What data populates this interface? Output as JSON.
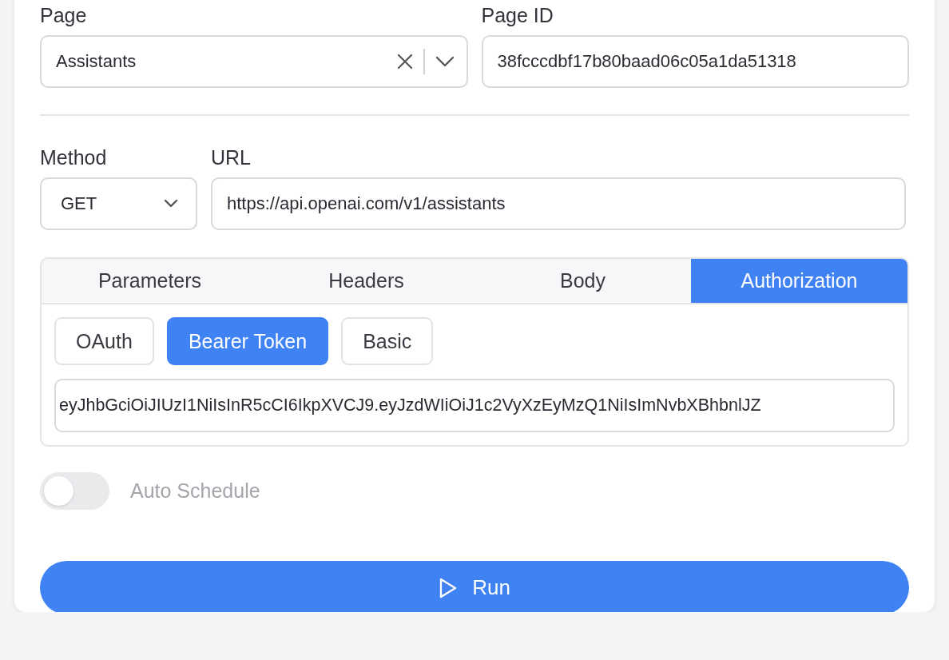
{
  "page_field": {
    "label": "Page",
    "value": "Assistants"
  },
  "page_id_field": {
    "label": "Page ID",
    "value": "38fcccdbf17b80baad06c05a1da51318"
  },
  "method_field": {
    "label": "Method",
    "value": "GET"
  },
  "url_field": {
    "label": "URL",
    "value": "https://api.openai.com/v1/assistants"
  },
  "tabs": [
    {
      "label": "Parameters",
      "selected": false
    },
    {
      "label": "Headers",
      "selected": false
    },
    {
      "label": "Body",
      "selected": false
    },
    {
      "label": "Authorization",
      "selected": true
    }
  ],
  "auth_types": [
    {
      "label": "OAuth",
      "selected": false
    },
    {
      "label": "Bearer Token",
      "selected": true
    },
    {
      "label": "Basic",
      "selected": false
    }
  ],
  "token_field": {
    "value": "eyJhbGciOiJIUzI1NiIsInR5cCI6IkpXVCJ9.eyJzdWIiOiJ1c2VyXzEyMzQ1NiIsImNvbXBhbnlJZ"
  },
  "auto_schedule": {
    "label": "Auto Schedule",
    "on": false,
    "disabled": true
  },
  "run_button": {
    "label": "Run"
  }
}
